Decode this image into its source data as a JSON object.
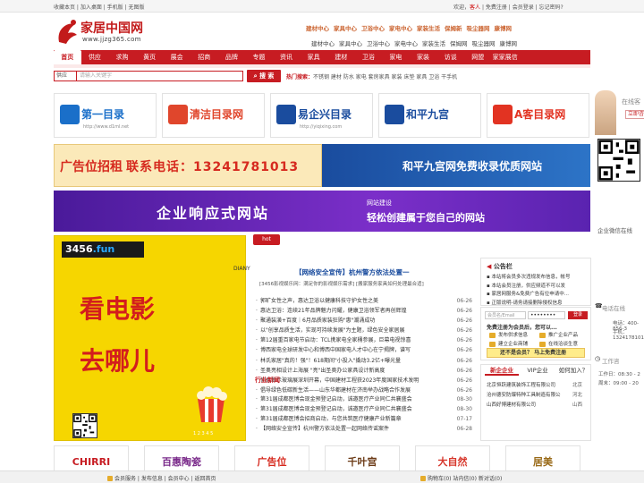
{
  "topbar": {
    "left": "收藏本页 | 加入桌面 | 手机版 | 无图版",
    "welcome": "欢迎，",
    "guest": "客人",
    "links": " | 免费注册 | 会员登录 | 忘记密码?"
  },
  "logo": {
    "name": "家居中国网",
    "domain": "www.jjzg365.com"
  },
  "channels_top": [
    "建材中心",
    "家具中心",
    "卫浴中心",
    "家电中心",
    "家装生活",
    "保姆新",
    "吸尘器网",
    "康博网"
  ],
  "channels_sub": [
    "建材中心",
    "家具中心",
    "卫浴中心",
    "家电中心",
    "家装生活",
    "保姆网",
    "吸尘器网",
    "康博网"
  ],
  "mainnav": [
    "首页",
    "供应",
    "求购",
    "黄页",
    "展会",
    "招商",
    "品牌",
    "专题",
    "资讯",
    "家具",
    "建材",
    "卫浴",
    "家电",
    "家装",
    "访谈",
    "网盟",
    "家家展信"
  ],
  "search": {
    "select": "供应",
    "placeholder": "请输入关键字",
    "button": "搜 索",
    "hot_label": "热门搜索：",
    "hot": "不锈钢  建材  防水  家电  套房家具  家装  床垫  家具  卫浴  干手机"
  },
  "logos": [
    {
      "title": "第一目录",
      "sub": "http://www.d1ml.net",
      "color": "#1a6fc9"
    },
    {
      "title": "清洁目录网",
      "sub": "",
      "color": "#e0462c"
    },
    {
      "title": "易企兴目录",
      "sub": "http://yiqixing.com",
      "color": "#1a4c9e"
    },
    {
      "title": "和平九宫",
      "sub": "",
      "color": "#1a4c9e"
    },
    {
      "title": "A客目录网",
      "sub": "",
      "color": "#e23322"
    }
  ],
  "banner1": {
    "ad_recruit": "广告位招租",
    "phone": "联系电话：13241781013",
    "right": "和平九宫网免费收录优质网站"
  },
  "banner2": {
    "main": "企业响应式网站",
    "s1": "网站建设",
    "s2": "轻松创建属于您自己的网站"
  },
  "film": {
    "domain_a": "3456",
    "domain_b": ".fun",
    "line1": "看电影",
    "line2": "去哪儿",
    "vert": "DIANY",
    "pager": "1 2 3 4 5"
  },
  "news": {
    "headline": "【网络安全宣传】杭州警方依法处置一",
    "sub": "[3456影视娱乐网：满足你的影视娱乐需求]    [搬家服务家具如何处理最合适]",
    "items": [
      {
        "t": "郭旷女性之声，惠达卫浴以健康科技守护女性之美",
        "d": "06-26"
      },
      {
        "t": "惠达卫浴：连续21年品牌魅力闪耀，健康卫浴领军者再创辉煌",
        "d": "06-26"
      },
      {
        "t": "聚通装潢+百度｜6月品质家装狂购\"惠\"潮涌成功",
        "d": "06-26"
      },
      {
        "t": "以\"创享品质生活，实现可持续发展\"为主题，绿色安全家居展",
        "d": "06-26"
      },
      {
        "t": "第12届重百家电节启动：TCL携家电全家桶参展，巨幕电视惊喜",
        "d": "06-26"
      },
      {
        "t": "博西家电全球研发中心和博西中国家电人才中心在宁揭牌，谱写",
        "d": "06-26"
      },
      {
        "t": "林氏家居\"真的！强\"！618期间\"小投入\"撬动3.2亿+曝光量",
        "d": "06-26"
      },
      {
        "t": "圣奥亮相设计上海展 \"亮\"出圣奥办公家具设计新高度",
        "d": "06-26"
      },
      {
        "t": "信息显示玻璃展深圳开幕，中国建材工程获2023年度国家技术发明",
        "d": "06-26"
      },
      {
        "t": "倡导绿色低碳新生活——山东华都建材在济南举办战略合作发展",
        "d": "06-26"
      }
    ],
    "tagline": "行业新闻",
    "items2": [
      {
        "t": "第31届成都医博会现金预登记启动，诚邀医疗产业同仁共襄盛会",
        "d": "08-30"
      },
      {
        "t": "第31届成都医博会现金预登记启动，诚邀医疗产业同仁共襄盛会",
        "d": "08-30"
      },
      {
        "t": "第31届成都医博会招商启动，与您共筑医疗健康产业新篇章",
        "d": "07-17"
      },
      {
        "t": "【网络安全宣传】杭州警方依法处置一起网络传谣案件",
        "d": "06-28"
      }
    ]
  },
  "sidebar": {
    "notice_title": "公告栏",
    "notices": [
      "▪ 本站将会员多次违规发布信息，帐号",
      "▪ 本站会员注册，供应频道不可以发",
      "▪ 家居网服务&免费广告有位申请中...",
      "▪ 正版说明-请务请接删除侵权信息"
    ],
    "login_placeholder": "会员名/Email",
    "login_password": "••••••••",
    "login_button": "登录",
    "login_tip": "免费注册为会员后，您可以...",
    "opts": [
      "发布供求信息",
      "推广企业产品",
      "建立企业商铺",
      "在线洽谈生意"
    ],
    "cta": "还不是会员？ 马上免费注册",
    "tabs": [
      "新企企业",
      "VIP企业",
      "如何加入？"
    ],
    "companies": [
      {
        "n": "北京恒跃建筑装饰工程有限公司",
        "r": "北京"
      },
      {
        "n": "沧州德安防爆特种工具制造有限公",
        "r": "河北"
      },
      {
        "n": "山西好博建材有限公司",
        "r": "山西"
      }
    ]
  },
  "rside": {
    "online": "在线客",
    "consult": "立即咨",
    "wechat": "企业微信在线",
    "phone_t": "电话在线",
    "phone_lines": [
      "电话：400-856-3",
      "手机：13241781013"
    ],
    "work_t": "工作咨",
    "time_lines": [
      "工作日：08:30 - 2",
      "周末：09:00 - 20"
    ]
  },
  "bottom_logos": [
    {
      "t": "CHIRRI",
      "c": "#c71c22"
    },
    {
      "t": "百惠陶瓷",
      "c": "#7a2a8a"
    },
    {
      "t": "广告位",
      "c": "#d62a1f"
    },
    {
      "t": "千叶宫",
      "c": "#6b3a16"
    },
    {
      "t": "大自然",
      "c": "#d7372c"
    },
    {
      "t": "居美",
      "c": "#9a6b1a"
    }
  ],
  "footbar": {
    "left": "会员服务 | 发布信息 | 会员中心 | 返回首页",
    "right": "购物车(0)     站内信(0)     新对话(0)"
  }
}
